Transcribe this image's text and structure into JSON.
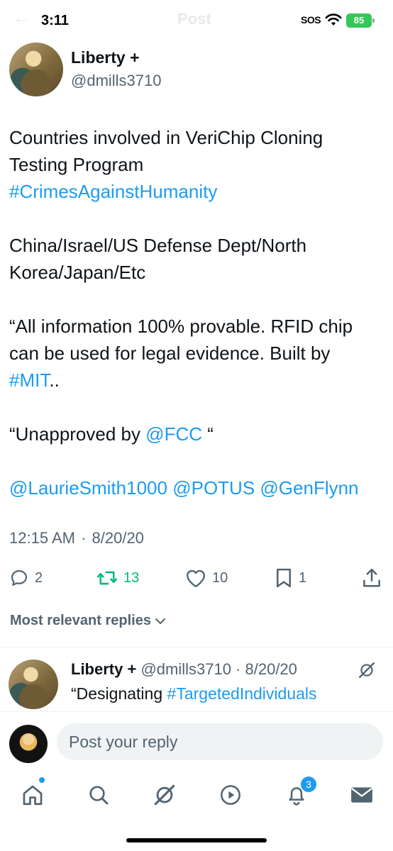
{
  "status_bar": {
    "time": "3:11",
    "sos": "SOS",
    "battery": "85"
  },
  "header": {
    "title": "Post"
  },
  "post": {
    "author_name": "Liberty +",
    "author_handle": "@dmills3710",
    "body": {
      "line1": "Countries involved in VeriChip Cloning Testing Program",
      "hashtag_crimes": "#CrimesAgainstHumanity",
      "countries": "China/Israel/US Defense Dept/North Korea/Japan/Etc",
      "quote_info": "“All information 100% provable. RFID chip can be used for legal evidence. Built by",
      "hashtag_mit": "#MIT",
      "mit_suffix": "..",
      "unapproved": "“Unapproved by",
      "mention_fcc": "@FCC",
      "fcc_suffix": " “",
      "mention_laurie": "@LaurieSmith1000",
      "mention_potus": "@POTUS",
      "mention_genflynn": "@GenFlynn"
    },
    "time": "12:15 AM",
    "date": "8/20/20",
    "stats": {
      "replies": "2",
      "reposts": "13",
      "likes": "10",
      "bookmarks": "1"
    }
  },
  "replies_filter": {
    "label": "Most relevant replies"
  },
  "reply": {
    "author_name": "Liberty +",
    "author_handle": "@dmills3710",
    "date": "8/20/20",
    "text_prefix": "“Designating ",
    "hashtag": "#TargetedIndividuals"
  },
  "composer": {
    "placeholder": "Post your reply"
  },
  "bottom_nav": {
    "notifications_count": "3",
    "items": [
      "home-icon",
      "search-icon",
      "grok-icon",
      "video-icon",
      "notifications-icon",
      "messages-icon"
    ]
  },
  "colors": {
    "link": "#1d9bf0",
    "repost_active": "#00ba7c",
    "secondary_text": "#536471",
    "battery": "#34c759"
  }
}
